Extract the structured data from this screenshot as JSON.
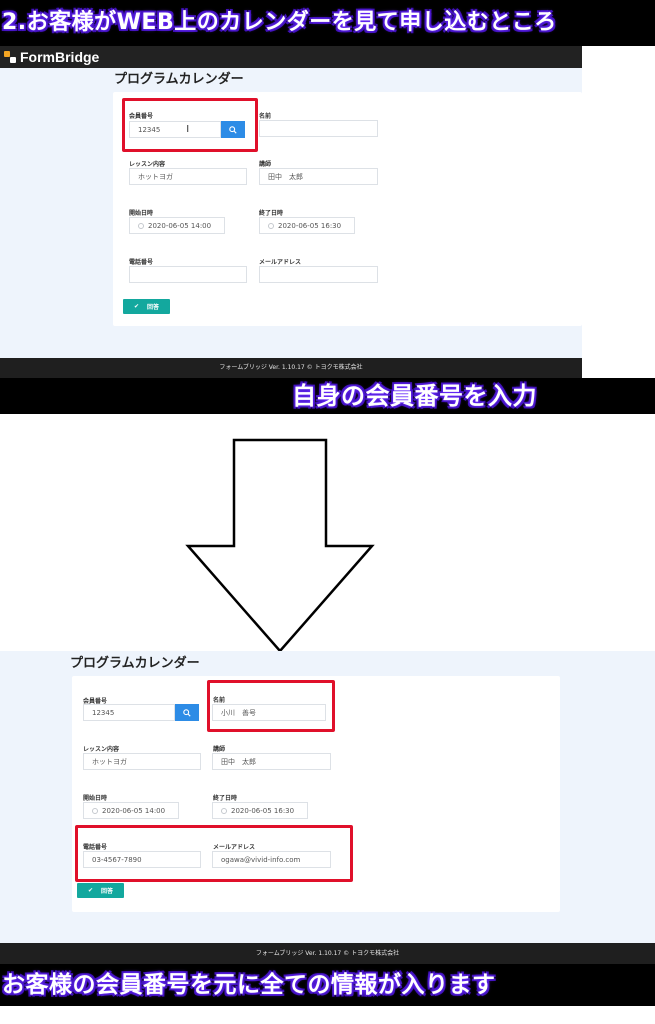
{
  "captions": {
    "top": "2.お客様がWEB上のカレンダーを見て申し込むところ",
    "middle": "自身の会員番号を入力",
    "bottom": "お客様の会員番号を元に全ての情報が入ります"
  },
  "app": {
    "brand": "FormBridge",
    "page_title": "プログラムカレンダー",
    "footer": "フォームブリッジ Ver. 1.10.17 © トヨクモ株式会社"
  },
  "labels": {
    "member_no": "会員番号",
    "name": "名前",
    "lesson": "レッスン内容",
    "instructor": "講師",
    "start": "開始日時",
    "end": "終了日時",
    "phone": "電話番号",
    "email": "メールアドレス",
    "submit": "回答"
  },
  "before": {
    "member_no": "12345",
    "name": "",
    "lesson": "ホットヨガ",
    "instructor": "田中　太郎",
    "start": "2020-06-05 14:00",
    "end": "2020-06-05 16:30",
    "phone": "",
    "email": ""
  },
  "after": {
    "member_no": "12345",
    "name": "小川　善号",
    "lesson": "ホットヨガ",
    "instructor": "田中　太郎",
    "start": "2020-06-05 14:00",
    "end": "2020-06-05 16:30",
    "phone": "03-4567-7890",
    "email": "ogawa@vivid-info.com"
  },
  "colors": {
    "accent_search": "#2d8ce6",
    "accent_submit": "#13a89e",
    "highlight": "#e0102a"
  }
}
